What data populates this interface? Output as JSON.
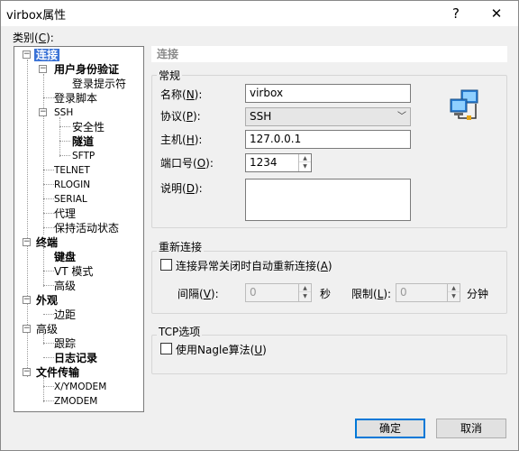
{
  "window": {
    "title": "virbox属性",
    "help_glyph": "?",
    "close_glyph": "✕"
  },
  "category_label": {
    "text": "类别(",
    "key": "C",
    "tail": "):"
  },
  "tree": {
    "connect": "连接",
    "user_auth": "用户身份验证",
    "login_prompt": "登录提示符",
    "login_script": "登录脚本",
    "ssh": "SSH",
    "security": "安全性",
    "tunnel": "隧道",
    "sftp": "SFTP",
    "telnet": "TELNET",
    "rlogin": "RLOGIN",
    "serial": "SERIAL",
    "proxy": "代理",
    "keepalive": "保持活动状态",
    "terminal": "终端",
    "keyboard": "键盘",
    "vt_mode": "VT 模式",
    "term_advanced": "高级",
    "appearance": "外观",
    "margin": "边距",
    "advanced": "高级",
    "trace": "跟踪",
    "log": "日志记录",
    "file_transfer": "文件传输",
    "xymodem": "X/YMODEM",
    "zmodem": "ZMODEM"
  },
  "panel": {
    "header": "连接",
    "general": {
      "title": "常规",
      "name_label": "名称(",
      "name_key": "N",
      "name_tail": "):",
      "name_value": "virbox",
      "protocol_label": "协议(",
      "protocol_key": "P",
      "protocol_tail": "):",
      "protocol_value": "SSH",
      "host_label": "主机(",
      "host_key": "H",
      "host_tail": "):",
      "host_value": "127.0.0.1",
      "port_label": "端口号(",
      "port_key": "O",
      "port_tail": "):",
      "port_value": "1234",
      "desc_label": "说明(",
      "desc_key": "D",
      "desc_tail": "):",
      "desc_value": ""
    },
    "reconnect": {
      "title": "重新连接",
      "auto_label": "连接异常关闭时自动重新连接(",
      "auto_key": "A",
      "auto_tail": ")",
      "auto_checked": false,
      "interval_label": "间隔(",
      "interval_key": "V",
      "interval_tail": "):",
      "interval_value": "0",
      "seconds_unit": "秒",
      "limit_label": "限制(",
      "limit_key": "L",
      "limit_tail": "):",
      "limit_value": "0",
      "minutes_unit": "分钟"
    },
    "tcp": {
      "title": "TCP选项",
      "nagle_label": "使用Nagle算法(",
      "nagle_key": "U",
      "nagle_tail": ")",
      "nagle_checked": false
    }
  },
  "buttons": {
    "ok": "确定",
    "cancel": "取消"
  },
  "colors": {
    "selection": "#3b73d6",
    "primary_border": "#0078d7"
  }
}
